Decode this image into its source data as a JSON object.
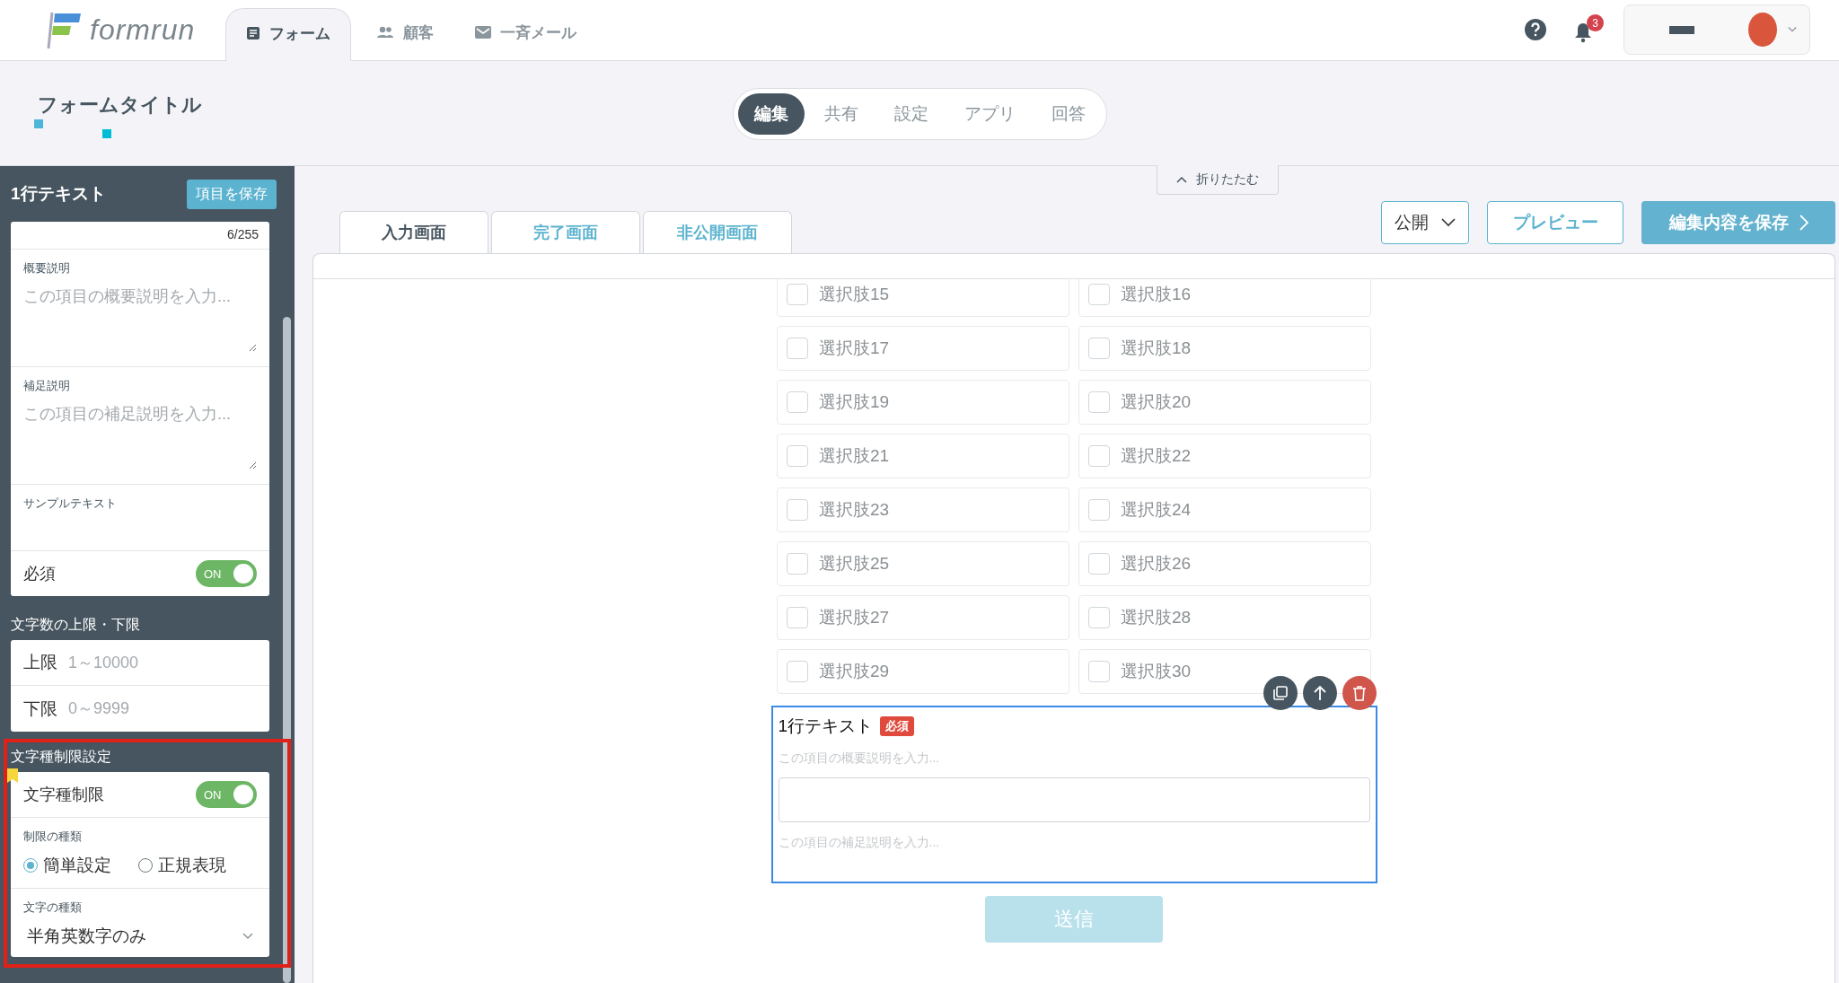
{
  "header": {
    "logo": "formrun",
    "nav": [
      {
        "label": "フォーム",
        "selected": true
      },
      {
        "label": "顧客",
        "selected": false
      },
      {
        "label": "一斉メール",
        "selected": false
      }
    ],
    "notification_count": "3"
  },
  "form_title": "フォームタイトル",
  "mode_tabs": [
    {
      "label": "編集",
      "selected": true
    },
    {
      "label": "共有",
      "selected": false
    },
    {
      "label": "設定",
      "selected": false
    },
    {
      "label": "アプリ",
      "selected": false
    },
    {
      "label": "回答",
      "selected": false
    }
  ],
  "collapse_button": "折りたたむ",
  "sidebar": {
    "title": "1行テキスト",
    "save_button": "項目を保存",
    "char_count": "6/255",
    "text_fields": [
      {
        "label": "概要説明",
        "placeholder": "この項目の概要説明を入力..."
      },
      {
        "label": "補足説明",
        "placeholder": "この項目の補足説明を入力..."
      }
    ],
    "sample_label": "サンプルテキスト",
    "required": {
      "label": "必須",
      "on": true,
      "toggle_text": "ON"
    },
    "length_section": {
      "title": "文字数の上限・下限",
      "rows": [
        {
          "label": "上限",
          "placeholder": "1～10000"
        },
        {
          "label": "下限",
          "placeholder": "0～9999"
        }
      ]
    },
    "char_type_section": {
      "title": "文字種制限設定",
      "toggle": {
        "label": "文字種制限",
        "on": true,
        "toggle_text": "ON"
      },
      "restriction": {
        "label": "制限の種類",
        "options": [
          {
            "label": "簡単設定",
            "selected": true
          },
          {
            "label": "正規表現",
            "selected": false
          }
        ]
      },
      "char_kind": {
        "label": "文字の種類",
        "value": "半角英数字のみ"
      }
    }
  },
  "screen_tabs": [
    {
      "label": "入力画面",
      "selected": true
    },
    {
      "label": "完了画面",
      "selected": false
    },
    {
      "label": "非公開画面",
      "selected": false
    }
  ],
  "publish_select": "公開",
  "preview_button": "プレビュー",
  "save_button": "編集内容を保存",
  "choices": [
    {
      "label": "選択肢15",
      "checked": false
    },
    {
      "label": "選択肢16",
      "checked": false
    },
    {
      "label": "選択肢17",
      "checked": false
    },
    {
      "label": "選択肢18",
      "checked": false
    },
    {
      "label": "選択肢19",
      "checked": false
    },
    {
      "label": "選択肢20",
      "checked": false
    },
    {
      "label": "選択肢21",
      "checked": false
    },
    {
      "label": "選択肢22",
      "checked": false
    },
    {
      "label": "選択肢23",
      "checked": false
    },
    {
      "label": "選択肢24",
      "checked": false
    },
    {
      "label": "選択肢25",
      "checked": false
    },
    {
      "label": "選択肢26",
      "checked": false
    },
    {
      "label": "選択肢27",
      "checked": false
    },
    {
      "label": "選択肢28",
      "checked": false
    },
    {
      "label": "選択肢29",
      "checked": false
    },
    {
      "label": "選択肢30",
      "checked": false
    }
  ],
  "selected_field": {
    "title": "1行テキスト",
    "required_badge": "必須",
    "description_hint": "この項目の概要説明を入力...",
    "help_hint": "この項目の補足説明を入力..."
  },
  "submit_button": "送信"
}
